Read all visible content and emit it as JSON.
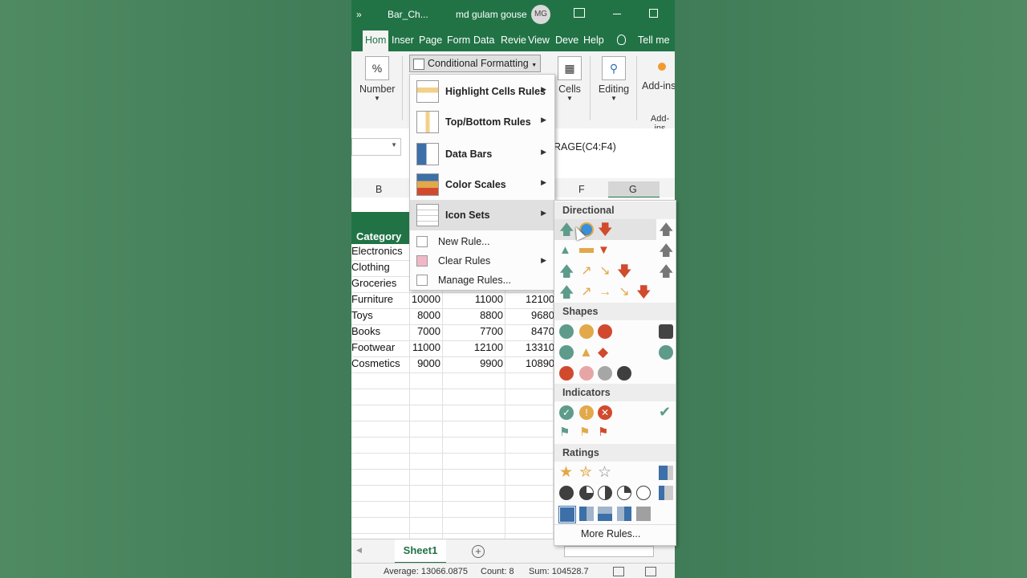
{
  "titlebar": {
    "more_glyph": "»",
    "filename": "Bar_Ch...",
    "user_name": "md gulam gouse",
    "avatar_initials": "MG"
  },
  "tabs": [
    "Hom",
    "Inser",
    "Page",
    "Form",
    "Data",
    "Revie",
    "View",
    "Deve",
    "Help",
    "Tell me"
  ],
  "ribbon": {
    "number_label": "Number",
    "percent_glyph": "%",
    "cf_label": "Conditional Formatting",
    "cells_label": "Cells",
    "editing_label": "Editing",
    "addins_label": "Add-ins",
    "addins_group": "Add-ins"
  },
  "formula": {
    "text": "RAGE(C4:F4)"
  },
  "columns": {
    "B": "B",
    "F": "F",
    "G": "G"
  },
  "table": {
    "header": "Category",
    "categories": [
      "Electronics",
      "Clothing",
      "Groceries",
      "Furniture",
      "Toys",
      "Books",
      "Footwear",
      "Cosmetics"
    ],
    "rows": [
      [
        "10000",
        "11000",
        "12100"
      ],
      [
        "8000",
        "8800",
        "9680"
      ],
      [
        "7000",
        "7700",
        "8470"
      ],
      [
        "11000",
        "12100",
        "13310"
      ],
      [
        "9000",
        "9900",
        "10890"
      ]
    ]
  },
  "sheet": {
    "tab": "Sheet1"
  },
  "status": {
    "average": "Average: 13066.0875",
    "count": "Count: 8",
    "sum": "Sum: 104528.7"
  },
  "cf_menu": {
    "items": [
      "Highlight Cells Rules",
      "Top/Bottom Rules",
      "Data Bars",
      "Color Scales",
      "Icon Sets"
    ],
    "small_items": [
      "New Rule...",
      "Clear Rules",
      "Manage Rules..."
    ]
  },
  "icon_sets": {
    "sections": [
      "Directional",
      "Shapes",
      "Indicators",
      "Ratings"
    ],
    "more_rules": "More Rules..."
  },
  "colors": {
    "excel_green": "#217346",
    "arrow_green": "#5e9b8a",
    "arrow_red": "#d14a2e",
    "arrow_yellow": "#e2a84a"
  }
}
